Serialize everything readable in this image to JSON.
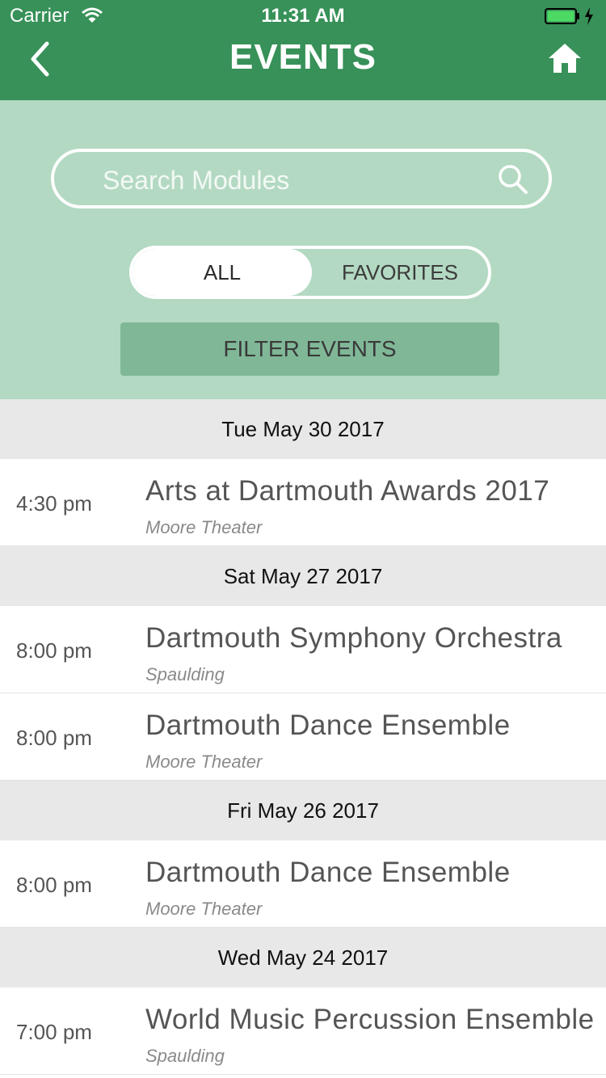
{
  "status_bar": {
    "carrier": "Carrier",
    "time": "11:31 AM"
  },
  "header": {
    "title": "EVENTS"
  },
  "search": {
    "placeholder": "Search Modules",
    "value": ""
  },
  "segmented": {
    "all_label": "ALL",
    "favorites_label": "FAVORITES",
    "selected": "ALL"
  },
  "filter_button": "FILTER EVENTS",
  "colors": {
    "header_bg": "#379158",
    "panel_bg": "#b3d9c2",
    "filter_bg": "#80b897",
    "section_bg": "#e8e8e8"
  },
  "sections": [
    {
      "date": "Tue May 30 2017",
      "events": [
        {
          "time": "4:30 pm",
          "title": "Arts at Dartmouth Awards 2017",
          "location": "Moore Theater"
        }
      ]
    },
    {
      "date": "Sat May 27 2017",
      "events": [
        {
          "time": "8:00 pm",
          "title": "Dartmouth Symphony Orchestra",
          "location": "Spaulding"
        },
        {
          "time": "8:00 pm",
          "title": "Dartmouth Dance Ensemble",
          "location": "Moore Theater"
        }
      ]
    },
    {
      "date": "Fri May 26 2017",
      "events": [
        {
          "time": "8:00 pm",
          "title": "Dartmouth Dance Ensemble",
          "location": "Moore Theater"
        }
      ]
    },
    {
      "date": "Wed May 24 2017",
      "events": [
        {
          "time": "7:00 pm",
          "title": "World Music Percussion Ensemble",
          "location": "Spaulding"
        }
      ]
    }
  ]
}
